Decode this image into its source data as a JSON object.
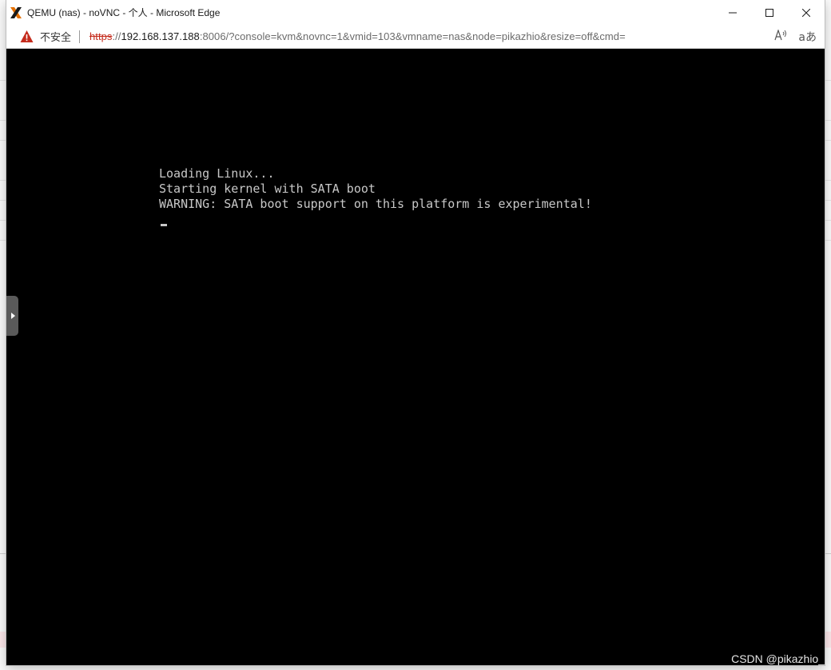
{
  "window": {
    "title": "QEMU (nas) - noVNC - 个人 - Microsoft Edge",
    "controls": {
      "minimize": "minimize-icon",
      "maximize": "maximize-icon",
      "close": "close-icon"
    }
  },
  "addressbar": {
    "security_label": "不安全",
    "url_scheme": "https",
    "url_sep": "://",
    "url_host": "192.168.137.188",
    "url_rest": ":8006/?console=kvm&novnc=1&vmid=103&vmname=nas&node=pikazhio&resize=off&cmd=",
    "read_aloud": "A̅",
    "translate": "aあ"
  },
  "console": {
    "lines": [
      "Loading Linux...",
      "Starting kernel with SATA boot",
      "WARNING: SATA boot support on this platform is experimental!"
    ]
  },
  "watermark": "CSDN @pikazhio_",
  "colors": {
    "insecure_red": "#c42b1c",
    "console_bg": "#000000",
    "console_text": "#c8c8c8"
  }
}
